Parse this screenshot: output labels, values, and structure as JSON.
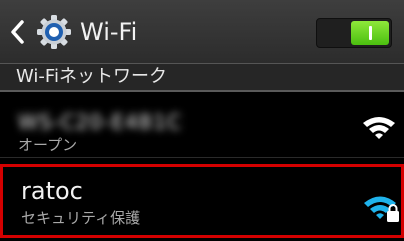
{
  "header": {
    "title": "Wi-Fi",
    "toggle_state": "on",
    "accent_color": "#5ccf1a"
  },
  "section": {
    "label": "Wi-Fiネットワーク"
  },
  "networks": [
    {
      "ssid": "WS-C20-E4B1C",
      "ssid_obscured": true,
      "security": "オープン",
      "signal_color": "#ffffff",
      "locked": false,
      "selected": false
    },
    {
      "ssid": "ratoc",
      "ssid_obscured": false,
      "security": "セキュリティ保護",
      "signal_color": "#1fb3ec",
      "locked": true,
      "selected": true
    }
  ],
  "highlight_color": "#d40000"
}
